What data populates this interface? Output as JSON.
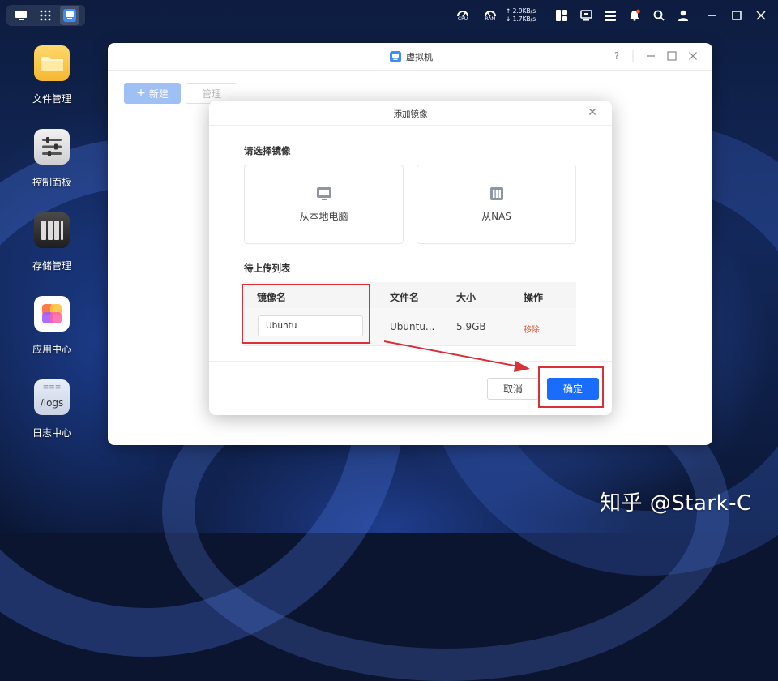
{
  "taskbar": {
    "cpu_label": "CPU",
    "ram_label": "RAM",
    "upload_speed": "2.9KB/s",
    "download_speed": "1.7KB/s",
    "notification_badge": true
  },
  "desktop_icons": [
    {
      "label": "文件管理",
      "icon": "folder-icon"
    },
    {
      "label": "控制面板",
      "icon": "control-panel-icon"
    },
    {
      "label": "存储管理",
      "icon": "storage-icon"
    },
    {
      "label": "应用中心",
      "icon": "app-center-icon"
    },
    {
      "label": "日志中心",
      "icon": "log-center-icon",
      "icon_text": "/logs"
    }
  ],
  "app_window": {
    "title": "虚拟机",
    "help": "?",
    "new_button": "新建",
    "manage_button": "管理"
  },
  "modal": {
    "title": "添加镜像",
    "select_section_title": "请选择镜像",
    "source_local": "从本地电脑",
    "source_nas": "从NAS",
    "upload_list_title": "待上传列表",
    "columns": [
      "镜像名",
      "文件名",
      "大小",
      "操作"
    ],
    "rows": [
      {
        "image_name": "Ubuntu",
        "file_name": "Ubuntu...",
        "size": "5.9GB",
        "action": "移除"
      }
    ],
    "cancel": "取消",
    "confirm": "确定"
  },
  "colors": {
    "primary": "#1a6cff",
    "highlight": "#d9303a",
    "danger_link": "#e05a3a"
  },
  "watermark": "知乎 @Stark-C"
}
